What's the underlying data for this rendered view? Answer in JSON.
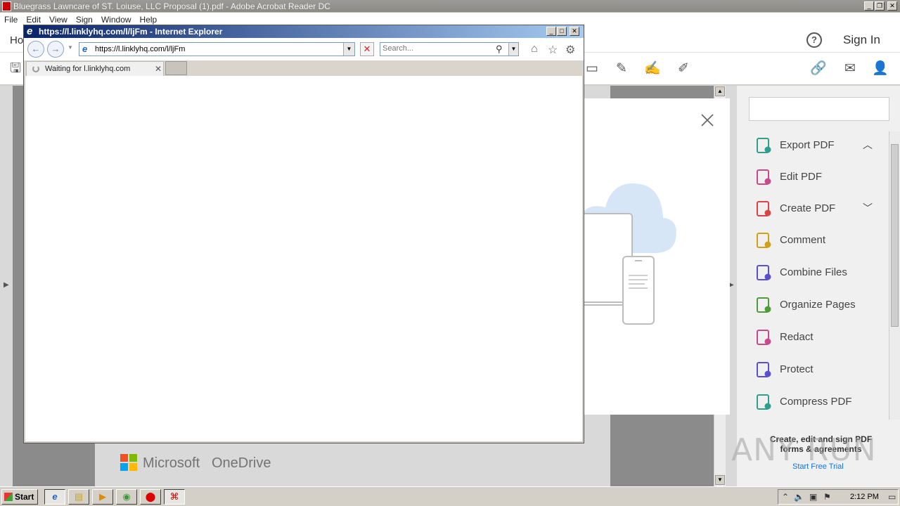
{
  "acrobat": {
    "title": "Bluegrass Lawncare of ST. Loiuse, LLC Proposal (1).pdf - Adobe Acrobat Reader DC",
    "menu": [
      "File",
      "Edit",
      "View",
      "Sign",
      "Window",
      "Help"
    ],
    "home_tab": "Ho",
    "help_label": "?",
    "sign_in": "Sign In"
  },
  "tools": {
    "items": [
      {
        "label": "Export PDF",
        "icon": "export-pdf-icon",
        "color": "#2d9f8c",
        "chevron": "up"
      },
      {
        "label": "Edit PDF",
        "icon": "edit-pdf-icon",
        "color": "#c64b8c",
        "chevron": ""
      },
      {
        "label": "Create PDF",
        "icon": "create-pdf-icon",
        "color": "#d94545",
        "chevron": "down"
      },
      {
        "label": "Comment",
        "icon": "comment-icon",
        "color": "#d2a017",
        "chevron": ""
      },
      {
        "label": "Combine Files",
        "icon": "combine-files-icon",
        "color": "#5a4fcf",
        "chevron": ""
      },
      {
        "label": "Organize Pages",
        "icon": "organize-pages-icon",
        "color": "#4f9b3a",
        "chevron": ""
      },
      {
        "label": "Redact",
        "icon": "redact-icon",
        "color": "#c64b8c",
        "chevron": ""
      },
      {
        "label": "Protect",
        "icon": "protect-icon",
        "color": "#5a4fcf",
        "chevron": ""
      },
      {
        "label": "Compress PDF",
        "icon": "compress-pdf-icon",
        "color": "#2d9f8c",
        "chevron": ""
      }
    ],
    "promo_title": "Create, edit and sign PDF forms & agreements",
    "promo_link": "Start Free Trial"
  },
  "footer": {
    "microsoft": "Microsoft",
    "onedrive": "OneDrive"
  },
  "watermark": "ANY RUN",
  "ie": {
    "title": "https://l.linklyhq.com/l/ljFm - Internet Explorer",
    "address": "https://l.linklyhq.com/l/ljFm",
    "search_placeholder": "Search...",
    "tab_label": "Waiting for l.linklyhq.com"
  },
  "taskbar": {
    "start": "Start",
    "clock": "2:12 PM"
  }
}
